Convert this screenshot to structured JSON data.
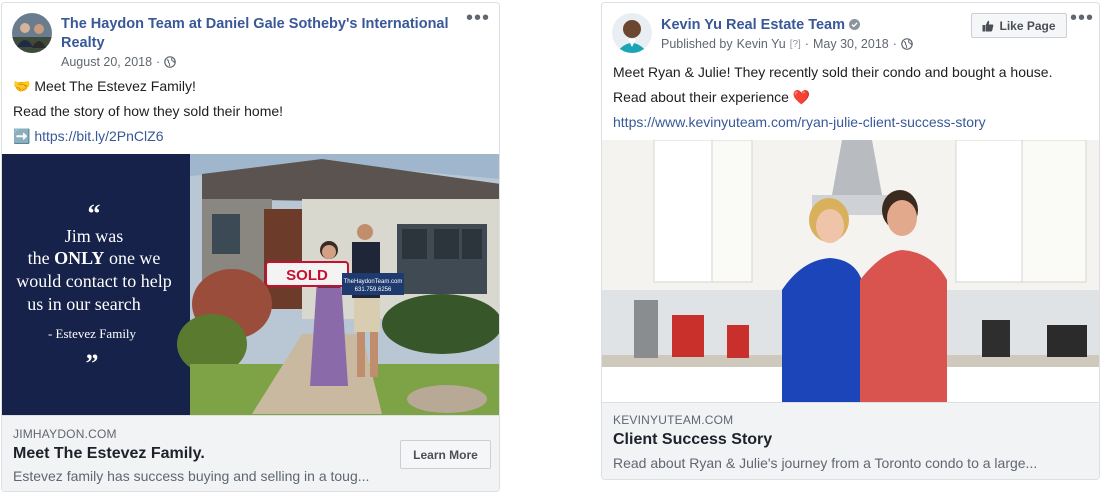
{
  "post_left": {
    "page_name": "The Haydon Team at Daniel Gale Sotheby's International Realty",
    "date": "August 20, 2018",
    "meta_separator": "·",
    "line1": "Meet The Estevez Family!",
    "line1_emoji": "🤝",
    "line2": "Read the story of how they sold their home!",
    "link_emoji": "➡️",
    "link": "https://bit.ly/2PnClZ6",
    "quote": {
      "line1": "Jim was",
      "line2_pre": "the ",
      "line2_bold": "ONLY",
      "line2_post": " one we",
      "line3": "would contact to help",
      "line4": "us in our search",
      "attribution": "- Estevez Family"
    },
    "sign": {
      "sold": "SOLD",
      "site": "TheHaydonTeam.com",
      "phone": "631.759.6256"
    },
    "footer": {
      "domain": "JIMHAYDON.COM",
      "title": "Meet The Estevez Family.",
      "description": "Estevez family has success buying and selling in a toug...",
      "button": "Learn More"
    }
  },
  "post_right": {
    "page_name": "Kevin Yu Real Estate Team",
    "published_by_label": "Published by",
    "published_by": "Kevin Yu",
    "published_q": "[?]",
    "date": "May 30, 2018",
    "meta_separator": "·",
    "like_button": "Like Page",
    "line1": "Meet Ryan & Julie! They recently sold their condo and bought a house.",
    "line2": "Read about their experience",
    "line2_emoji": "❤️",
    "link": "https://www.kevinyuteam.com/ryan-julie-client-success-story",
    "footer": {
      "domain": "KEVINYUTEAM.COM",
      "title": "Client Success Story",
      "description": "Read about Ryan & Julie's journey from a Toronto condo to a large..."
    }
  },
  "colors": {
    "link_blue": "#385898",
    "navy_panel": "#16224a",
    "footer_bg": "#f2f3f5",
    "sold_red": "#c8102e",
    "heart_red": "#e02020"
  },
  "icons": {
    "more": "more-dots-icon",
    "globe": "globe-icon",
    "like": "thumbs-up-icon",
    "verified": "verified-badge-icon"
  }
}
